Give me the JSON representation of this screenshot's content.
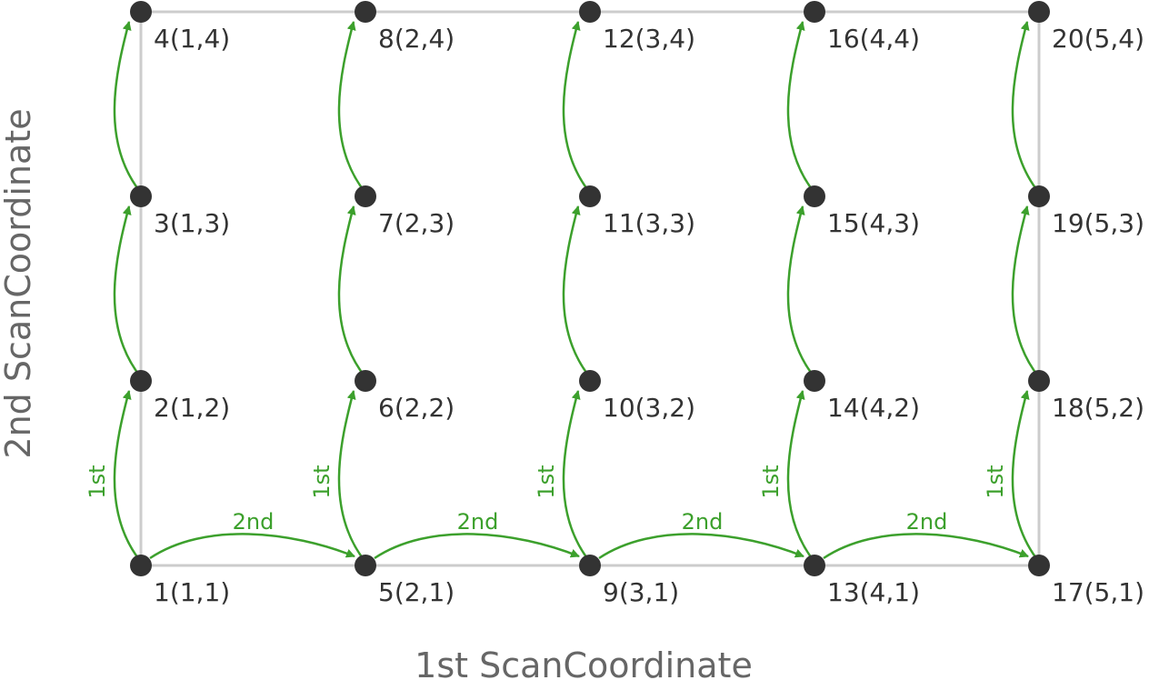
{
  "axes": {
    "x_label": "1st ScanCoordinate",
    "y_label": "2nd ScanCoordinate"
  },
  "colors": {
    "node": "#333333",
    "arrow": "#3ca02c",
    "grid": "#cccccc",
    "axis_label": "#666666"
  },
  "grid": {
    "columns": 5,
    "rows": 4
  },
  "nodes": [
    {
      "index": 1,
      "i": 1,
      "j": 1,
      "label": "1(1,1)"
    },
    {
      "index": 2,
      "i": 1,
      "j": 2,
      "label": "2(1,2)"
    },
    {
      "index": 3,
      "i": 1,
      "j": 3,
      "label": "3(1,3)"
    },
    {
      "index": 4,
      "i": 1,
      "j": 4,
      "label": "4(1,4)"
    },
    {
      "index": 5,
      "i": 2,
      "j": 1,
      "label": "5(2,1)"
    },
    {
      "index": 6,
      "i": 2,
      "j": 2,
      "label": "6(2,2)"
    },
    {
      "index": 7,
      "i": 2,
      "j": 3,
      "label": "7(2,3)"
    },
    {
      "index": 8,
      "i": 2,
      "j": 4,
      "label": "8(2,4)"
    },
    {
      "index": 9,
      "i": 3,
      "j": 1,
      "label": "9(3,1)"
    },
    {
      "index": 10,
      "i": 3,
      "j": 2,
      "label": "10(3,2)"
    },
    {
      "index": 11,
      "i": 3,
      "j": 3,
      "label": "11(3,3)"
    },
    {
      "index": 12,
      "i": 3,
      "j": 4,
      "label": "12(3,4)"
    },
    {
      "index": 13,
      "i": 4,
      "j": 1,
      "label": "13(4,1)"
    },
    {
      "index": 14,
      "i": 4,
      "j": 2,
      "label": "14(4,2)"
    },
    {
      "index": 15,
      "i": 4,
      "j": 3,
      "label": "15(4,3)"
    },
    {
      "index": 16,
      "i": 4,
      "j": 4,
      "label": "16(4,4)"
    },
    {
      "index": 17,
      "i": 5,
      "j": 1,
      "label": "17(5,1)"
    },
    {
      "index": 18,
      "i": 5,
      "j": 2,
      "label": "18(5,2)"
    },
    {
      "index": 19,
      "i": 5,
      "j": 3,
      "label": "19(5,3)"
    },
    {
      "index": 20,
      "i": 5,
      "j": 4,
      "label": "20(5,4)"
    }
  ],
  "order_labels": {
    "first": "1st",
    "second": "2nd"
  }
}
